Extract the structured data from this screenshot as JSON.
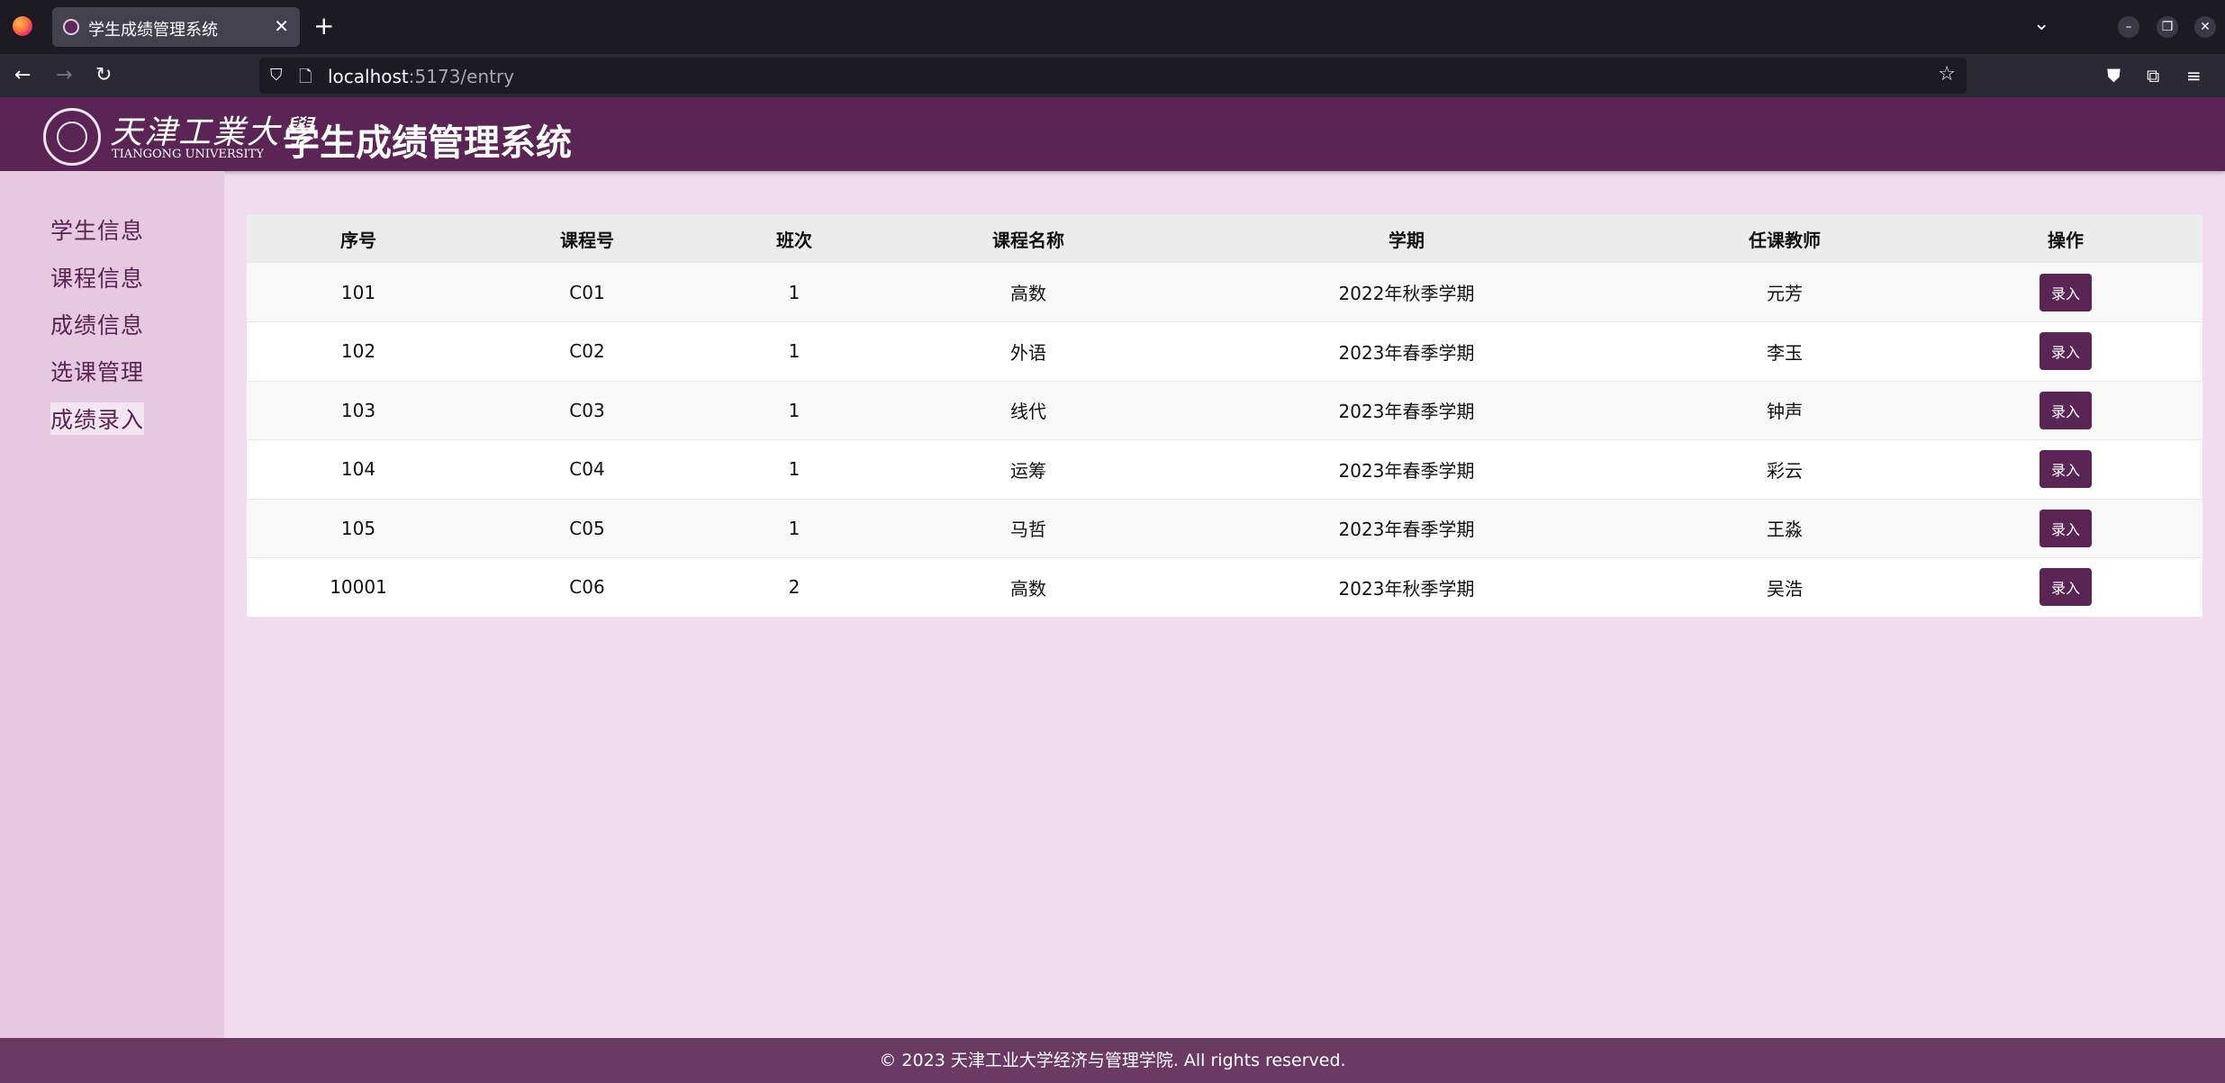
{
  "browser": {
    "tab_title": "学生成绩管理系统",
    "url_host": "localhost",
    "url_rest": ":5173/entry"
  },
  "header": {
    "university_cn": "天津工業大學",
    "university_en": "TIANGONG UNIVERSITY",
    "title": "学生成绩管理系统"
  },
  "sidebar": {
    "items": [
      {
        "label": "学生信息"
      },
      {
        "label": "课程信息"
      },
      {
        "label": "成绩信息"
      },
      {
        "label": "选课管理"
      },
      {
        "label": "成绩录入"
      }
    ]
  },
  "table": {
    "columns": [
      "序号",
      "课程号",
      "班次",
      "课程名称",
      "学期",
      "任课教师",
      "操作"
    ],
    "rows": [
      {
        "id": "101",
        "course_no": "C01",
        "class_no": "1",
        "course_name": "高数",
        "term": "2022年秋季学期",
        "teacher": "元芳",
        "action": "录入"
      },
      {
        "id": "102",
        "course_no": "C02",
        "class_no": "1",
        "course_name": "外语",
        "term": "2023年春季学期",
        "teacher": "李玉",
        "action": "录入"
      },
      {
        "id": "103",
        "course_no": "C03",
        "class_no": "1",
        "course_name": "线代",
        "term": "2023年春季学期",
        "teacher": "钟声",
        "action": "录入"
      },
      {
        "id": "104",
        "course_no": "C04",
        "class_no": "1",
        "course_name": "运筹",
        "term": "2023年春季学期",
        "teacher": "彩云",
        "action": "录入"
      },
      {
        "id": "105",
        "course_no": "C05",
        "class_no": "1",
        "course_name": "马哲",
        "term": "2023年春季学期",
        "teacher": "王淼",
        "action": "录入"
      },
      {
        "id": "10001",
        "course_no": "C06",
        "class_no": "2",
        "course_name": "高数",
        "term": "2023年秋季学期",
        "teacher": "吴浩",
        "action": "录入"
      }
    ]
  },
  "footer": {
    "text": "© 2023 天津工业大学经济与管理学院. All rights reserved."
  },
  "colors": {
    "brand": "#5a2455",
    "sidebar": "#e6c8e0",
    "background": "#f0dcec",
    "footer": "#6a3a64"
  }
}
